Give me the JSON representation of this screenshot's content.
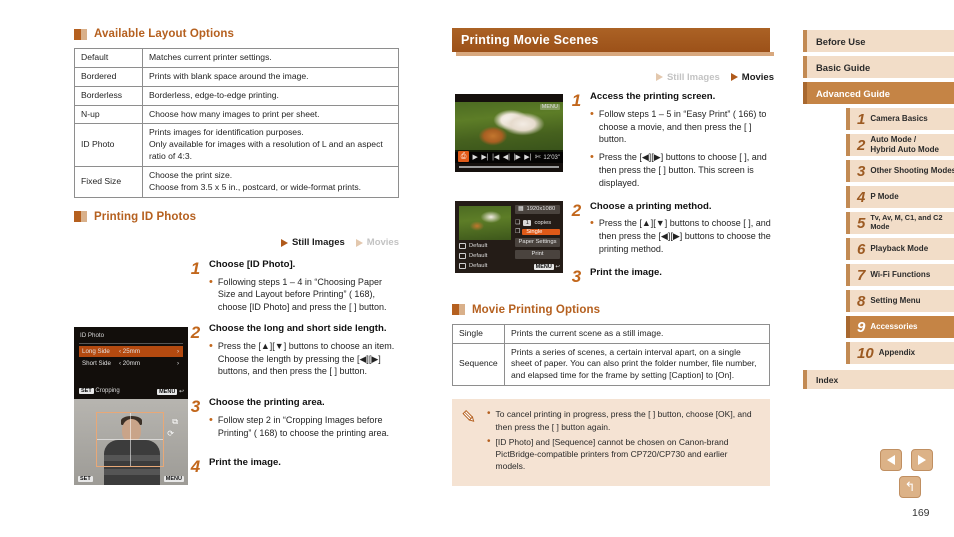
{
  "left_column": {
    "section1": {
      "heading": "Available Layout Options",
      "table": {
        "rows": [
          {
            "key": "Default",
            "value": "Matches current printer settings."
          },
          {
            "key": "Bordered",
            "value": "Prints with blank space around the image."
          },
          {
            "key": "Borderless",
            "value": "Borderless, edge-to-edge printing."
          },
          {
            "key": "N-up",
            "value": "Choose how many images to print per sheet."
          },
          {
            "key": "ID Photo",
            "value": "Prints images for identification purposes.\nOnly available for images with a resolution of L and an aspect ratio of 4:3."
          },
          {
            "key": "Fixed Size",
            "value": "Choose the print size.\nChoose from 3.5 x 5 in., postcard, or wide-format prints."
          }
        ]
      }
    },
    "section2": {
      "heading": "Printing ID Photos",
      "media": {
        "still_label": "Still Images",
        "still_active": true,
        "movies_label": "Movies",
        "movies_active": false
      },
      "steps": [
        {
          "num": "1",
          "title": "Choose [ID Photo].",
          "bullets": [
            "Following steps 1 – 4 in “Choosing Paper Size and Layout before Printing” ( 168), choose [ID Photo] and press the [ ] button."
          ]
        },
        {
          "num": "2",
          "title": "Choose the long and short side length.",
          "bullets": [
            "Press the [▲][▼] buttons to choose an item. Choose the length by pressing the [◀][▶] buttons, and then press the [ ] button."
          ]
        },
        {
          "num": "3",
          "title": "Choose the printing area.",
          "bullets": [
            "Follow step 2 in “Cropping Images before Printing” ( 168) to choose the printing area."
          ]
        },
        {
          "num": "4",
          "title": "Print the image.",
          "bullets": []
        }
      ],
      "screens": {
        "id_photo": {
          "title": "ID Photo",
          "rows": [
            {
              "label": "Long Side",
              "value": "25mm",
              "selected": true
            },
            {
              "label": "Short Side",
              "value": "20mm",
              "selected": false
            }
          ],
          "footer_left_tag": "SET",
          "footer_left": "Cropping",
          "footer_right_tag": "MENU"
        },
        "cropping": {
          "footer_left_tag": "SET",
          "footer_right_tag": "MENU"
        }
      }
    }
  },
  "middle_column": {
    "banner_title": "Printing Movie Scenes",
    "media": {
      "still_label": "Still Images",
      "still_active": false,
      "movies_label": "Movies",
      "movies_active": true
    },
    "steps": [
      {
        "num": "1",
        "title": "Access the printing screen.",
        "bullets": [
          "Follow steps 1 – 5 in “Easy Print” ( 166) to choose a movie, and then press the [ ] button.",
          "Press the [◀][▶] buttons to choose [ ], and then press the [ ] button. This screen is displayed."
        ]
      },
      {
        "num": "2",
        "title": "Choose a printing method.",
        "bullets": [
          "Press the [▲][▼] buttons to choose [ ], and then press the [◀][▶] buttons to choose the printing method."
        ]
      },
      {
        "num": "3",
        "title": "Print the image.",
        "bullets": []
      }
    ],
    "screens": {
      "movie_playback": {
        "timecode": "12'03\"",
        "menu_tag": "MENU"
      },
      "print_settings": {
        "resolution": "1920x1080",
        "copies_value": "1",
        "copies_label": "copies",
        "method_value": "Single",
        "paper_settings_label": "Paper Settings",
        "print_label": "Print",
        "left_rows": [
          "Default",
          "Default",
          "Default"
        ],
        "menu_tag": "MENU"
      }
    },
    "section": {
      "heading": "Movie Printing Options",
      "table": {
        "rows": [
          {
            "key": "Single",
            "value": "Prints the current scene as a still image."
          },
          {
            "key": "Sequence",
            "value": "Prints a series of scenes, a certain interval apart, on a single sheet of paper. You can also print the folder number, file number, and elapsed time for the frame by setting [Caption] to [On]."
          }
        ]
      }
    },
    "note": {
      "icon": "pencil-icon",
      "items": [
        "To cancel printing in progress, press the [ ] button, choose [OK], and then press the [ ] button again.",
        "[ID Photo] and [Sequence] cannot be chosen on Canon-brand PictBridge-compatible printers from CP720/CP730 and earlier models."
      ]
    }
  },
  "right_nav": {
    "top_items": [
      {
        "label": "Before Use",
        "active": false
      },
      {
        "label": "Basic Guide",
        "active": false
      },
      {
        "label": "Advanced Guide",
        "active": true
      }
    ],
    "chapters": [
      {
        "num": "1",
        "label": "Camera Basics",
        "active": false
      },
      {
        "num": "2",
        "label": "Auto Mode /\nHybrid Auto Mode",
        "active": false
      },
      {
        "num": "3",
        "label": "Other Shooting Modes",
        "active": false
      },
      {
        "num": "4",
        "label": "P Mode",
        "active": false
      },
      {
        "num": "5",
        "label": "Tv, Av, M, C1, and C2 Mode",
        "active": false
      },
      {
        "num": "6",
        "label": "Playback Mode",
        "active": false
      },
      {
        "num": "7",
        "label": "Wi-Fi Functions",
        "active": false
      },
      {
        "num": "8",
        "label": "Setting Menu",
        "active": false
      },
      {
        "num": "9",
        "label": "Accessories",
        "active": true
      },
      {
        "num": "10",
        "label": "Appendix",
        "active": false
      }
    ],
    "index_label": "Index"
  },
  "pager": {
    "prev_icon": "arrow-left-icon",
    "next_icon": "arrow-right-icon",
    "home_icon": "return-home-icon",
    "page_number": "169"
  },
  "colors": {
    "accent": "#b5601f",
    "banner": "#a3581f",
    "nav_bg": "#f2ddc8",
    "nav_active": "#c58445",
    "note_bg": "#f5e3d3"
  }
}
